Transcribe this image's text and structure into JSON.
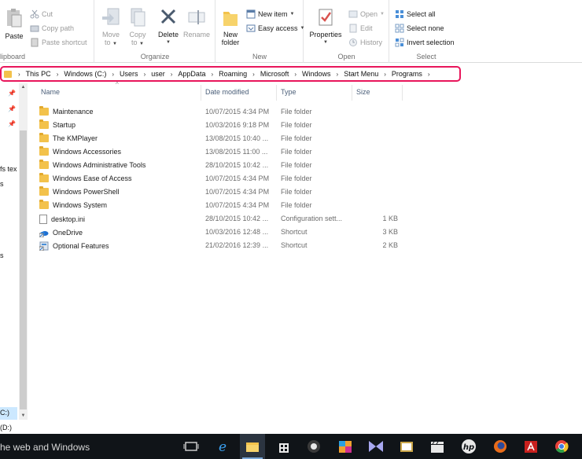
{
  "ribbon": {
    "clipboard": {
      "label": "lipboard",
      "paste": "Paste",
      "cut": "Cut",
      "copy_path": "Copy path",
      "paste_shortcut": "Paste shortcut"
    },
    "organize": {
      "label": "Organize",
      "move_to_1": "Move",
      "move_to_2": "to",
      "copy_to_1": "Copy",
      "copy_to_2": "to",
      "delete": "Delete",
      "rename": "Rename"
    },
    "new": {
      "label": "New",
      "new_folder_1": "New",
      "new_folder_2": "folder",
      "new_item": "New item",
      "easy_access": "Easy access"
    },
    "open": {
      "label": "Open",
      "properties": "Properties",
      "open": "Open",
      "edit": "Edit",
      "history": "History"
    },
    "select": {
      "label": "Select",
      "select_all": "Select all",
      "select_none": "Select none",
      "invert_selection": "Invert selection"
    }
  },
  "breadcrumb": [
    "This PC",
    "Windows (C:)",
    "Users",
    "user",
    "AppData",
    "Roaming",
    "Microsoft",
    "Windows",
    "Start Menu",
    "Programs"
  ],
  "nav": {
    "frag1": "fs tex",
    "frag2": "s",
    "frag3": "s",
    "drive_c": "C:)",
    "drive_d": "(D:)"
  },
  "columns": {
    "name": "Name",
    "date": "Date modified",
    "type": "Type",
    "size": "Size"
  },
  "files": [
    {
      "name": "Maintenance",
      "date": "10/07/2015 4:34 PM",
      "type": "File folder",
      "size": "",
      "icon": "folder-icon"
    },
    {
      "name": "Startup",
      "date": "10/03/2016 9:18 PM",
      "type": "File folder",
      "size": "",
      "icon": "folder-icon"
    },
    {
      "name": "The KMPlayer",
      "date": "13/08/2015 10:40 ...",
      "type": "File folder",
      "size": "",
      "icon": "folder-icon"
    },
    {
      "name": "Windows Accessories",
      "date": "13/08/2015 11:00 ...",
      "type": "File folder",
      "size": "",
      "icon": "folder-icon"
    },
    {
      "name": "Windows Administrative Tools",
      "date": "28/10/2015 10:42 ...",
      "type": "File folder",
      "size": "",
      "icon": "folder-icon"
    },
    {
      "name": "Windows Ease of Access",
      "date": "10/07/2015 4:34 PM",
      "type": "File folder",
      "size": "",
      "icon": "folder-icon"
    },
    {
      "name": "Windows PowerShell",
      "date": "10/07/2015 4:34 PM",
      "type": "File folder",
      "size": "",
      "icon": "folder-icon"
    },
    {
      "name": "Windows System",
      "date": "10/07/2015 4:34 PM",
      "type": "File folder",
      "size": "",
      "icon": "folder-icon"
    },
    {
      "name": "desktop.ini",
      "date": "28/10/2015 10:42 ...",
      "type": "Configuration sett...",
      "size": "1 KB",
      "icon": "file-icon"
    },
    {
      "name": "OneDrive",
      "date": "10/03/2016 12:48 ...",
      "type": "Shortcut",
      "size": "3 KB",
      "icon": "onedrive-shortcut-icon"
    },
    {
      "name": "Optional Features",
      "date": "21/02/2016 12:39 ...",
      "type": "Shortcut",
      "size": "2 KB",
      "icon": "optional-features-shortcut-icon"
    }
  ],
  "taskbar": {
    "search_text": "he web and Windows",
    "icons": [
      "task-view-icon",
      "edge-icon",
      "file-explorer-icon",
      "store-icon",
      "media-player-icon",
      "paint-icon",
      "visual-studio-icon",
      "slides-icon",
      "clapperboard-icon",
      "hp-icon",
      "firefox-icon",
      "acrobat-icon",
      "chrome-icon"
    ]
  },
  "colors": {
    "address_highlight": "#e8165b",
    "folder": "#f3c24b",
    "taskbar": "#101418",
    "selection": "#cce8ff"
  }
}
